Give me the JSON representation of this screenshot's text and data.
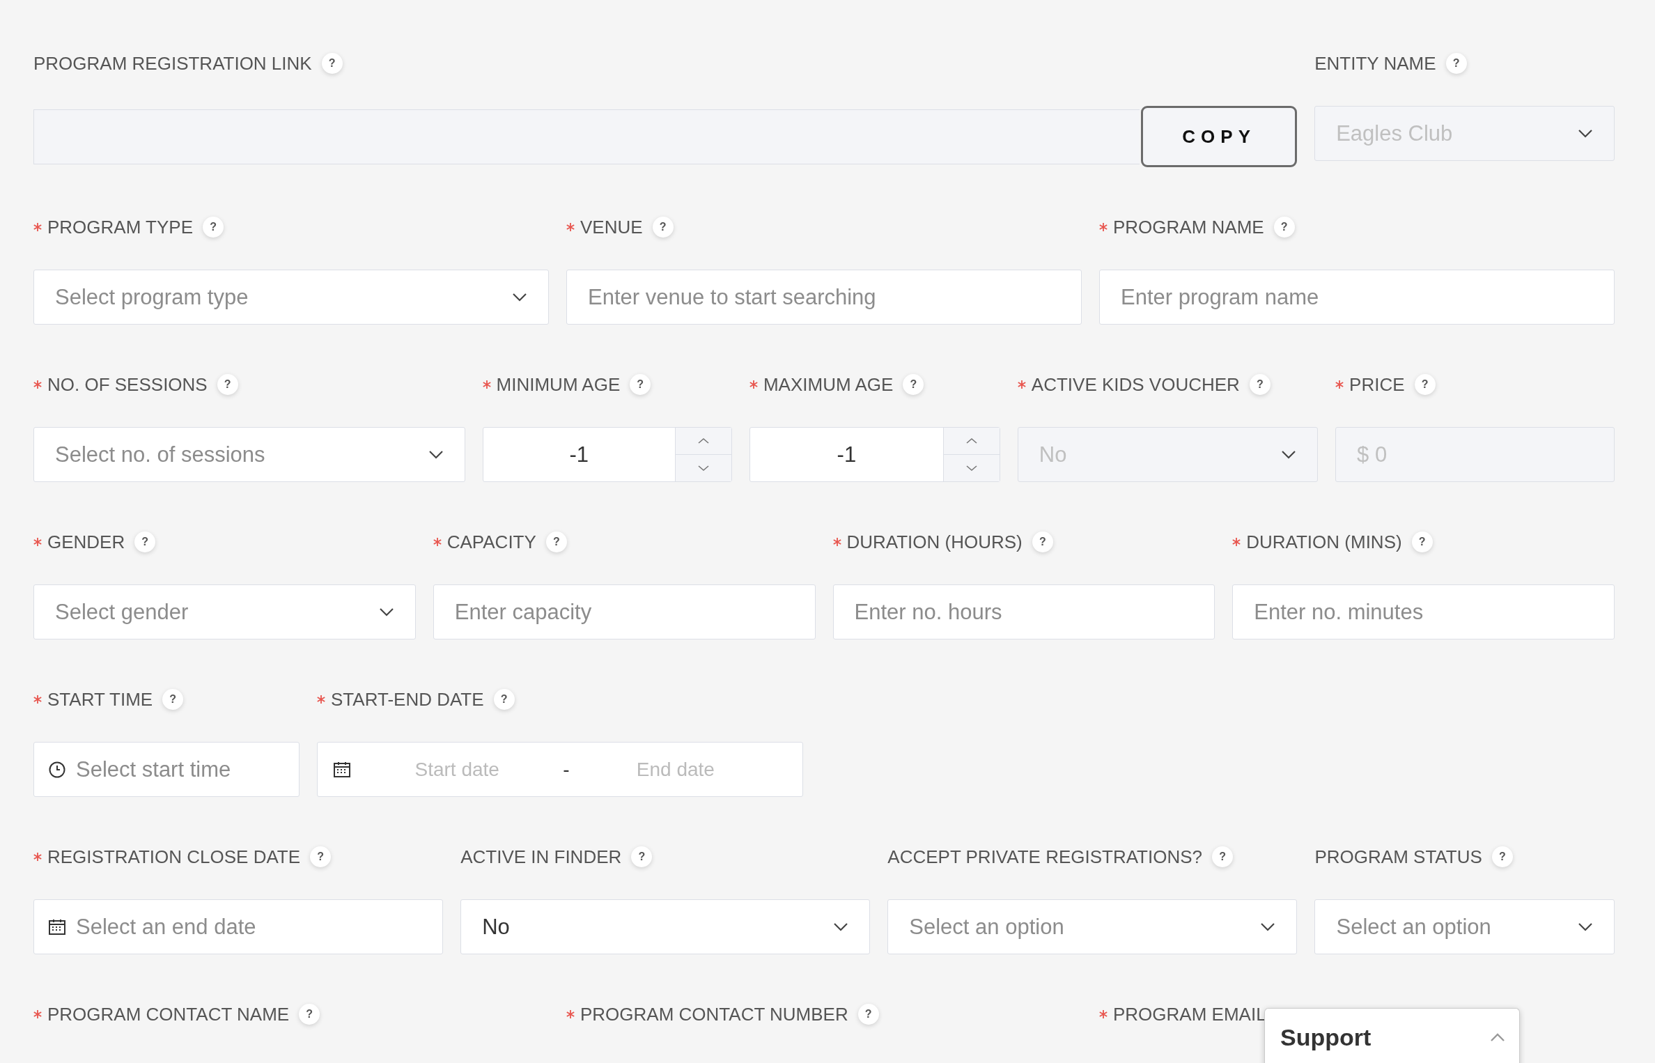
{
  "rows": [
    {
      "fields": [
        {
          "kind": "link",
          "label": "PROGRAM REGISTRATION LINK",
          "required": false,
          "help": "?",
          "button": "COPY"
        },
        {
          "kind": "select",
          "label": "ENTITY NAME",
          "required": false,
          "help": "?",
          "value": "Eagles Club",
          "disabled": true
        }
      ]
    },
    {
      "fields": [
        {
          "kind": "select",
          "label": "PROGRAM TYPE",
          "required": true,
          "help": "?",
          "placeholder": "Select program type",
          "disabled": false
        },
        {
          "kind": "text",
          "label": "VENUE",
          "required": true,
          "help": "?",
          "placeholder": "Enter venue to start searching",
          "disabled": false
        },
        {
          "kind": "text",
          "label": "PROGRAM NAME",
          "required": true,
          "help": "?",
          "placeholder": "Enter program name",
          "disabled": false
        }
      ]
    },
    {
      "fields": [
        {
          "kind": "select",
          "label": "NO. OF SESSIONS",
          "required": true,
          "help": "?",
          "placeholder": "Select no. of sessions",
          "disabled": false
        },
        {
          "kind": "number",
          "label": "MINIMUM AGE",
          "required": true,
          "help": "?",
          "value": "-1"
        },
        {
          "kind": "number",
          "label": "MAXIMUM AGE",
          "required": true,
          "help": "?",
          "value": "-1"
        },
        {
          "kind": "select",
          "label": "ACTIVE KIDS VOUCHER",
          "required": true,
          "help": "?",
          "value": "No",
          "disabled": true
        },
        {
          "kind": "text",
          "label": "PRICE",
          "required": true,
          "help": "?",
          "value": "$ 0",
          "disabled": true
        }
      ]
    },
    {
      "fields": [
        {
          "kind": "select",
          "label": "GENDER",
          "required": true,
          "help": "?",
          "placeholder": "Select gender",
          "disabled": false
        },
        {
          "kind": "text",
          "label": "CAPACITY",
          "required": true,
          "help": "?",
          "placeholder": "Enter capacity",
          "disabled": false
        },
        {
          "kind": "text",
          "label": "DURATION (HOURS)",
          "required": true,
          "help": "?",
          "placeholder": "Enter no. hours",
          "disabled": false
        },
        {
          "kind": "text",
          "label": "DURATION (MINS)",
          "required": true,
          "help": "?",
          "placeholder": "Enter no. minutes",
          "disabled": false
        }
      ]
    },
    {
      "fields": [
        {
          "kind": "time",
          "label": "START TIME",
          "required": true,
          "help": "?",
          "placeholder": "Select start time"
        },
        {
          "kind": "daterange",
          "label": "START-END DATE",
          "required": true,
          "help": "?",
          "start_placeholder": "Start date",
          "separator": "-",
          "end_placeholder": "End date"
        }
      ]
    },
    {
      "fields": [
        {
          "kind": "date",
          "label": "REGISTRATION CLOSE DATE",
          "required": true,
          "help": "?",
          "placeholder": "Select an end date"
        },
        {
          "kind": "select",
          "label": "ACTIVE IN FINDER",
          "required": false,
          "help": "?",
          "value": "No",
          "disabled": false
        },
        {
          "kind": "select",
          "label": "ACCEPT PRIVATE REGISTRATIONS?",
          "required": false,
          "help": "?",
          "placeholder": "Select an option",
          "disabled": false
        },
        {
          "kind": "select",
          "label": "PROGRAM STATUS",
          "required": false,
          "help": "?",
          "placeholder": "Select an option",
          "disabled": false
        }
      ]
    },
    {
      "fields": [
        {
          "label": "PROGRAM CONTACT NAME",
          "required": true,
          "help": "?"
        },
        {
          "label": "PROGRAM CONTACT NUMBER",
          "required": true,
          "help": "?"
        },
        {
          "label": "PROGRAM EMAIL",
          "required": true
        }
      ]
    }
  ],
  "support": {
    "title": "Support",
    "expanded": false
  }
}
